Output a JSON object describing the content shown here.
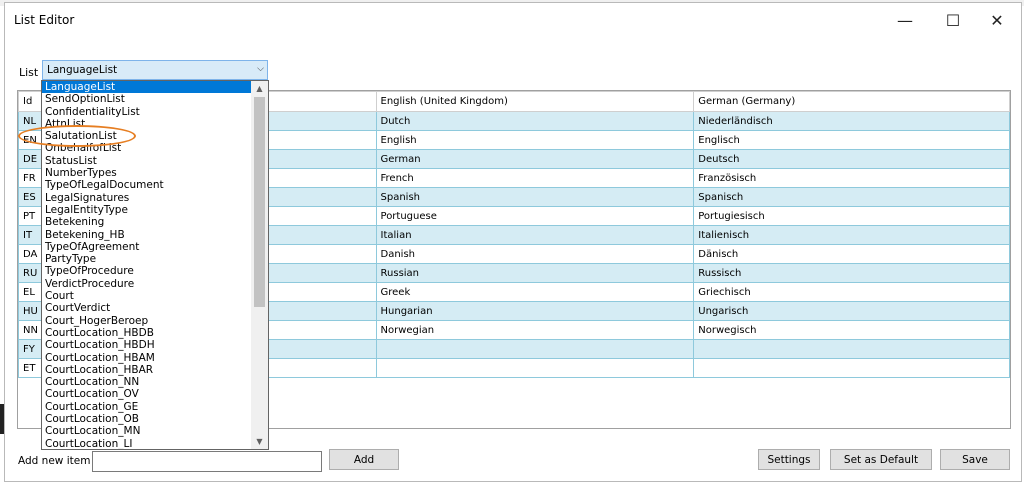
{
  "window": {
    "title": "List Editor",
    "minimize_glyph": "—",
    "maximize_glyph": "☐",
    "close_glyph": "✕"
  },
  "list_selector": {
    "label": "List",
    "selected": "LanguageList"
  },
  "dropdown_options": [
    "LanguageList",
    "SendOptionList",
    "ConfidentialityList",
    "AttnList",
    "SalutationList",
    "OnbehalfofList",
    "StatusList",
    "NumberTypes",
    "TypeOfLegalDocument",
    "LegalSignatures",
    "LegalEntityType",
    "Betekening",
    "Betekening_HB",
    "TypeOfAgreement",
    "PartyType",
    "TypeOfProcedure",
    "VerdictProcedure",
    "Court",
    "CourtVerdict",
    "Court_HogerBeroep",
    "CourtLocation_HBDB",
    "CourtLocation_HBDH",
    "CourtLocation_HBAM",
    "CourtLocation_HBAR",
    "CourtLocation_NN",
    "CourtLocation_OV",
    "CourtLocation_GE",
    "CourtLocation_OB",
    "CourtLocation_MN",
    "CourtLocation_LI"
  ],
  "grid": {
    "columns": [
      "Id",
      "English (United Kingdom)",
      "German (Germany)"
    ],
    "rows": [
      {
        "id": "NL",
        "en": "Dutch",
        "de": "Niederländisch"
      },
      {
        "id": "EN",
        "en": "English",
        "de": "Englisch"
      },
      {
        "id": "DE",
        "en": "German",
        "de": "Deutsch"
      },
      {
        "id": "FR",
        "en": "French",
        "de": "Französisch"
      },
      {
        "id": "ES",
        "en": "Spanish",
        "de": "Spanisch"
      },
      {
        "id": "PT",
        "en": "Portuguese",
        "de": "Portugiesisch"
      },
      {
        "id": "IT",
        "en": "Italian",
        "de": "Italienisch"
      },
      {
        "id": "DA",
        "en": "Danish",
        "de": "Dänisch"
      },
      {
        "id": "RU",
        "en": "Russian",
        "de": "Russisch"
      },
      {
        "id": "EL",
        "en": "Greek",
        "de": "Griechisch"
      },
      {
        "id": "HU",
        "en": "Hungarian",
        "de": "Ungarisch"
      },
      {
        "id": "NN",
        "en": "Norwegian",
        "de": "Norwegisch"
      },
      {
        "id": "FY",
        "en": "",
        "de": ""
      },
      {
        "id": "ET",
        "en": "",
        "de": ""
      }
    ]
  },
  "footer": {
    "add_label": "Add new item",
    "add_value": "",
    "add_button": "Add",
    "settings_button": "Settings",
    "default_button": "Set as Default",
    "save_button": "Save"
  },
  "colors": {
    "row_alt": "#d5ecf4",
    "grid_border": "#8ec9dc",
    "selection": "#0078d7",
    "annotation": "#e67e22"
  }
}
